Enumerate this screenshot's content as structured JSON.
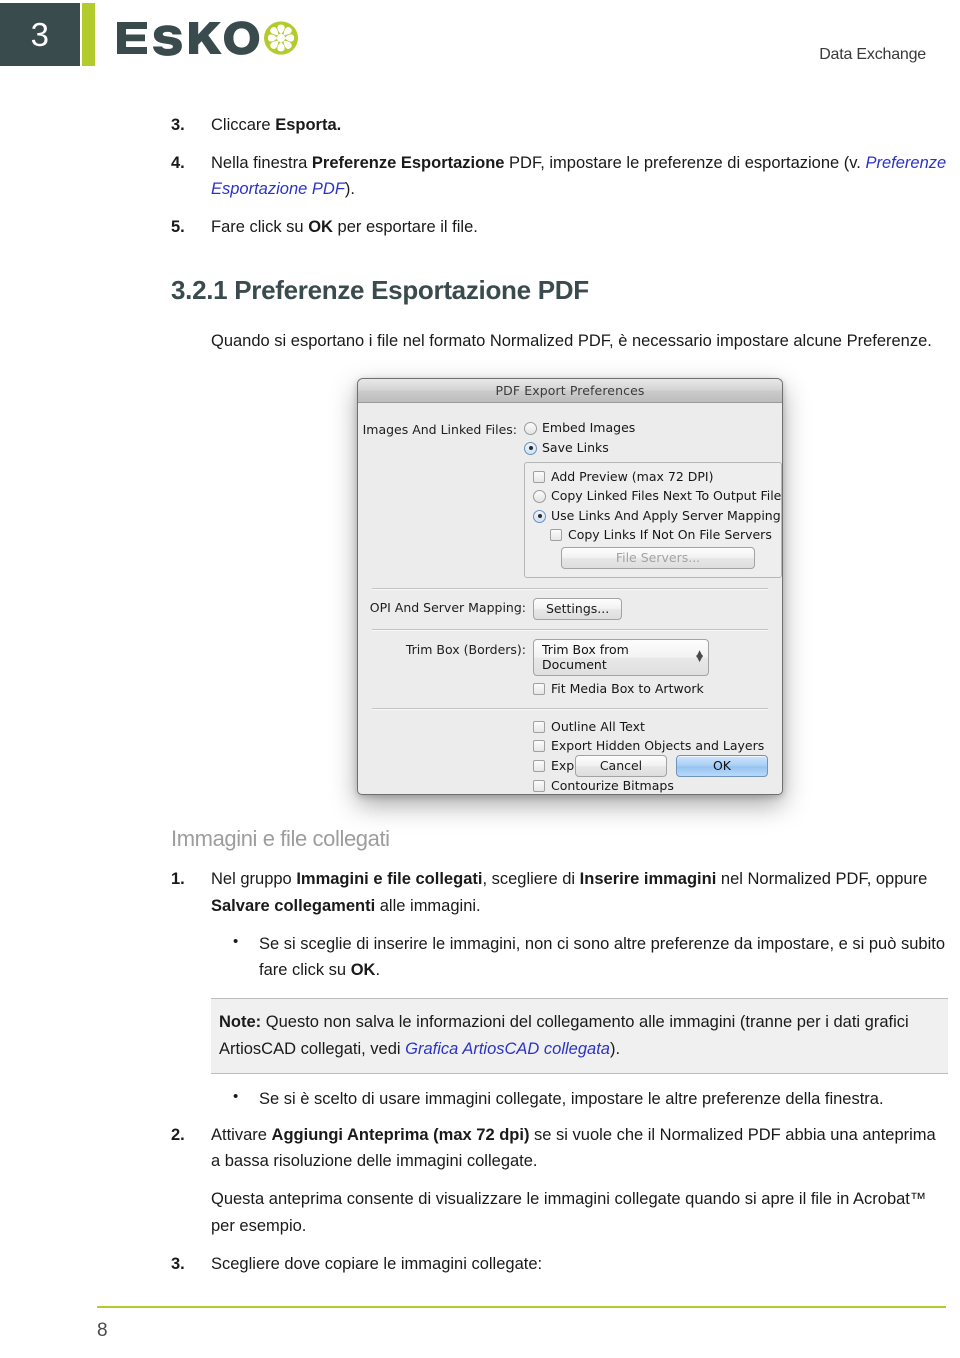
{
  "header": {
    "chapter_number": "3",
    "logo_text": "ESKO",
    "doc_title": "Data Exchange"
  },
  "steps_top": [
    {
      "marker": "3.",
      "segments": [
        {
          "text": "Cliccare ",
          "style": "normal"
        },
        {
          "text": "Esporta.",
          "style": "bold"
        }
      ]
    },
    {
      "marker": "4.",
      "justify": true,
      "segments": [
        {
          "text": "Nella finestra ",
          "style": "normal"
        },
        {
          "text": "Preferenze Esportazione",
          "style": "bold"
        },
        {
          "text": " PDF, impostare le preferenze di esportazione (v. ",
          "style": "normal"
        },
        {
          "text": "Preferenze Esportazione PDF",
          "style": "xref"
        },
        {
          "text": ").",
          "style": "normal"
        }
      ]
    },
    {
      "marker": "5.",
      "segments": [
        {
          "text": "Fare click su ",
          "style": "normal"
        },
        {
          "text": "OK",
          "style": "bold"
        },
        {
          "text": " per esportare il file.",
          "style": "normal"
        }
      ]
    }
  ],
  "section": {
    "heading": "3.2.1 Preferenze Esportazione PDF",
    "intro": "Quando si esportano i file nel formato Normalized PDF, è necessario impostare alcune Preferenze."
  },
  "dialog": {
    "title": "PDF Export Preferences",
    "images_label": "Images And Linked Files:",
    "radio_embed": {
      "label": "Embed Images",
      "selected": false
    },
    "radio_save_links": {
      "label": "Save Links",
      "selected": true
    },
    "group": {
      "check_add_preview": {
        "label": "Add Preview (max 72 DPI)",
        "checked": false
      },
      "radio_copy_next": {
        "label": "Copy Linked Files Next To Output File",
        "selected": false
      },
      "radio_use_links": {
        "label": "Use Links And Apply Server Mapping",
        "selected": true
      },
      "check_copy_if_not": {
        "label": "Copy Links If Not On File Servers",
        "checked": false
      },
      "file_servers_button": {
        "label": "File Servers...",
        "disabled": true
      }
    },
    "opi_label": "OPI And Server Mapping:",
    "settings_button": "Settings...",
    "trimbox_label": "Trim Box (Borders):",
    "trimbox_value": "Trim Box from Document",
    "check_fit_media": {
      "label": "Fit Media Box to Artwork",
      "checked": false
    },
    "check_outline_text": {
      "label": "Outline All Text",
      "checked": false
    },
    "check_export_hidden": {
      "label": "Export Hidden Objects and Layers",
      "checked": false
    },
    "check_expand_patterns": {
      "label": "Expand Patterns",
      "checked": false
    },
    "check_contourize": {
      "label": "Contourize Bitmaps",
      "checked": false
    },
    "cancel_button": "Cancel",
    "ok_button": "OK"
  },
  "subsection": {
    "heading": "Immagini e file collegati"
  },
  "steps_bottom": [
    {
      "marker": "1.",
      "segments": [
        {
          "text": "Nel gruppo ",
          "style": "normal"
        },
        {
          "text": "Immagini e file collegati",
          "style": "bold"
        },
        {
          "text": ", scegliere di ",
          "style": "normal"
        },
        {
          "text": "Inserire immagini",
          "style": "bold"
        },
        {
          "text": " nel Normalized PDF, oppure ",
          "style": "normal"
        },
        {
          "text": "Salvare collegamenti",
          "style": "bold"
        },
        {
          "text": " alle immagini.",
          "style": "normal"
        }
      ]
    }
  ],
  "bullet_1": [
    {
      "text": "Se si sceglie di inserire le immagini, non ci sono altre preferenze da impostare, e si può subito fare click su ",
      "style": "normal"
    },
    {
      "text": "OK",
      "style": "bold"
    },
    {
      "text": ".",
      "style": "normal"
    }
  ],
  "note": [
    {
      "text": "Note:",
      "style": "bold"
    },
    {
      "text": "  Questo non salva le informazioni del collegamento alle immagini (tranne per i dati grafici ArtiosCAD collegati, vedi ",
      "style": "normal"
    },
    {
      "text": "Grafica ArtiosCAD collegata",
      "style": "xref"
    },
    {
      "text": ").",
      "style": "normal"
    }
  ],
  "bullet_2": [
    {
      "text": "Se si è scelto di usare immagini collegate, impostare le altre preferenze della finestra.",
      "style": "normal"
    }
  ],
  "steps_bottom2": [
    {
      "marker": "2.",
      "segments": [
        {
          "text": "Attivare ",
          "style": "normal"
        },
        {
          "text": "Aggiungi Anteprima (max 72 dpi)",
          "style": "bold"
        },
        {
          "text": " se si vuole che il Normalized PDF abbia una anteprima a bassa risoluzione delle immagini collegate.",
          "style": "normal"
        }
      ]
    }
  ],
  "paragraph_acrobat": "Questa anteprima consente di visualizzare le immagini collegate quando si apre il file in Acrobat™ per esempio.",
  "steps_bottom3": [
    {
      "marker": "3.",
      "segments": [
        {
          "text": "Scegliere dove copiare le immagini collegate:",
          "style": "normal"
        }
      ]
    }
  ],
  "footer": {
    "page_number": "8"
  },
  "colors": {
    "badge_dark": "#3a4b4e",
    "accent_green": "#b3cb2c",
    "xref_blue": "#2b34c4",
    "subheading_gray": "#9d9d9d"
  }
}
